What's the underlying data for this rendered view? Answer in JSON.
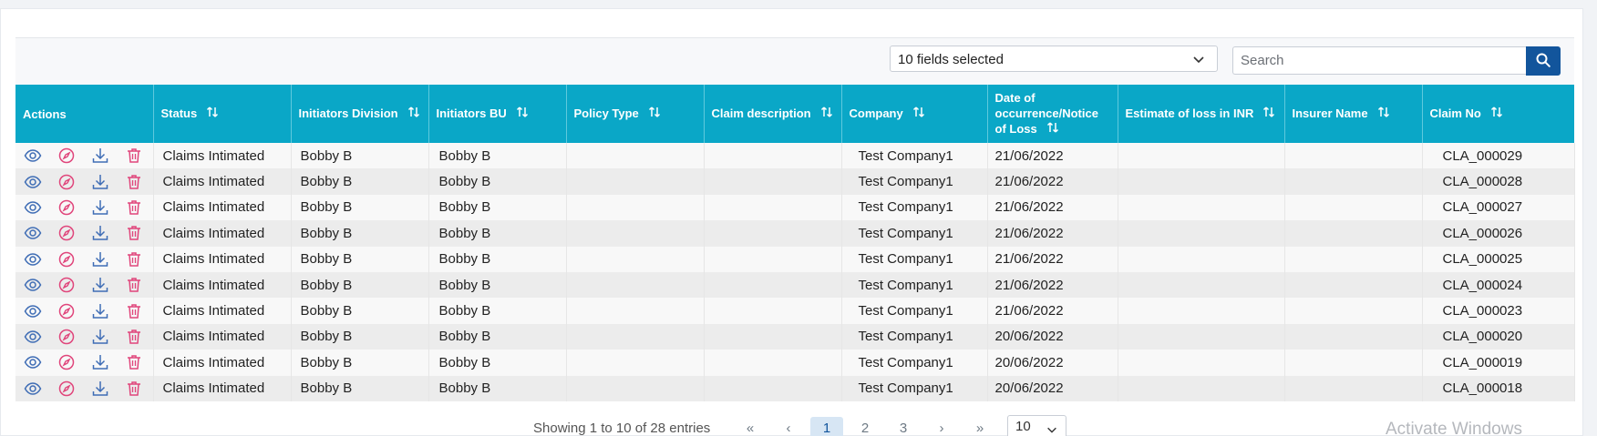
{
  "toolbar": {
    "fields_selected": "10 fields selected",
    "search_placeholder": "Search"
  },
  "table": {
    "columns": [
      {
        "label": "Actions",
        "sortable": false
      },
      {
        "label": "Status",
        "sortable": true
      },
      {
        "label": "Initiators Division",
        "sortable": true
      },
      {
        "label": "Initiators BU",
        "sortable": true
      },
      {
        "label": "Policy Type",
        "sortable": true
      },
      {
        "label": "Claim description",
        "sortable": true
      },
      {
        "label": "Company",
        "sortable": true
      },
      {
        "label": "Date of occurrence/Notice of Loss",
        "sortable": true
      },
      {
        "label": "Estimate of loss in INR",
        "sortable": true
      },
      {
        "label": "Insurer Name",
        "sortable": true
      },
      {
        "label": "Claim No",
        "sortable": true
      }
    ],
    "rows": [
      {
        "status": "Claims Intimated",
        "division": "Bobby B",
        "bu": "Bobby B",
        "policy_type": "",
        "claim_description": "",
        "company": "Test Company1",
        "date": "21/06/2022",
        "estimate": "",
        "insurer": "",
        "claim_no": "CLA_000029"
      },
      {
        "status": "Claims Intimated",
        "division": "Bobby B",
        "bu": "Bobby B",
        "policy_type": "",
        "claim_description": "",
        "company": "Test Company1",
        "date": "21/06/2022",
        "estimate": "",
        "insurer": "",
        "claim_no": "CLA_000028"
      },
      {
        "status": "Claims Intimated",
        "division": "Bobby B",
        "bu": "Bobby B",
        "policy_type": "",
        "claim_description": "",
        "company": "Test Company1",
        "date": "21/06/2022",
        "estimate": "",
        "insurer": "",
        "claim_no": "CLA_000027"
      },
      {
        "status": "Claims Intimated",
        "division": "Bobby B",
        "bu": "Bobby B",
        "policy_type": "",
        "claim_description": "",
        "company": "Test Company1",
        "date": "21/06/2022",
        "estimate": "",
        "insurer": "",
        "claim_no": "CLA_000026"
      },
      {
        "status": "Claims Intimated",
        "division": "Bobby B",
        "bu": "Bobby B",
        "policy_type": "",
        "claim_description": "",
        "company": "Test Company1",
        "date": "21/06/2022",
        "estimate": "",
        "insurer": "",
        "claim_no": "CLA_000025"
      },
      {
        "status": "Claims Intimated",
        "division": "Bobby B",
        "bu": "Bobby B",
        "policy_type": "",
        "claim_description": "",
        "company": "Test Company1",
        "date": "21/06/2022",
        "estimate": "",
        "insurer": "",
        "claim_no": "CLA_000024"
      },
      {
        "status": "Claims Intimated",
        "division": "Bobby B",
        "bu": "Bobby B",
        "policy_type": "",
        "claim_description": "",
        "company": "Test Company1",
        "date": "21/06/2022",
        "estimate": "",
        "insurer": "",
        "claim_no": "CLA_000023"
      },
      {
        "status": "Claims Intimated",
        "division": "Bobby B",
        "bu": "Bobby B",
        "policy_type": "",
        "claim_description": "",
        "company": "Test Company1",
        "date": "20/06/2022",
        "estimate": "",
        "insurer": "",
        "claim_no": "CLA_000020"
      },
      {
        "status": "Claims Intimated",
        "division": "Bobby B",
        "bu": "Bobby B",
        "policy_type": "",
        "claim_description": "",
        "company": "Test Company1",
        "date": "20/06/2022",
        "estimate": "",
        "insurer": "",
        "claim_no": "CLA_000019"
      },
      {
        "status": "Claims Intimated",
        "division": "Bobby B",
        "bu": "Bobby B",
        "policy_type": "",
        "claim_description": "",
        "company": "Test Company1",
        "date": "20/06/2022",
        "estimate": "",
        "insurer": "",
        "claim_no": "CLA_000018"
      }
    ],
    "row_actions": [
      {
        "name": "view-icon",
        "color": "#3f6db5"
      },
      {
        "name": "compass-icon",
        "color": "#e0457b"
      },
      {
        "name": "download-icon",
        "color": "#3f6db5"
      },
      {
        "name": "trash-icon",
        "color": "#e0457b"
      }
    ]
  },
  "pagination": {
    "showing": "Showing 1 to 10 of 28 entries",
    "first": "«",
    "prev": "‹",
    "pages": [
      "1",
      "2",
      "3"
    ],
    "active_page": "1",
    "next": "›",
    "last": "»",
    "page_size": "10"
  },
  "watermark": "Activate Windows",
  "colors": {
    "header_bg": "#0aa7c7",
    "search_button": "#12559c",
    "accent_pink": "#e0457b",
    "accent_blue": "#3f6db5"
  }
}
